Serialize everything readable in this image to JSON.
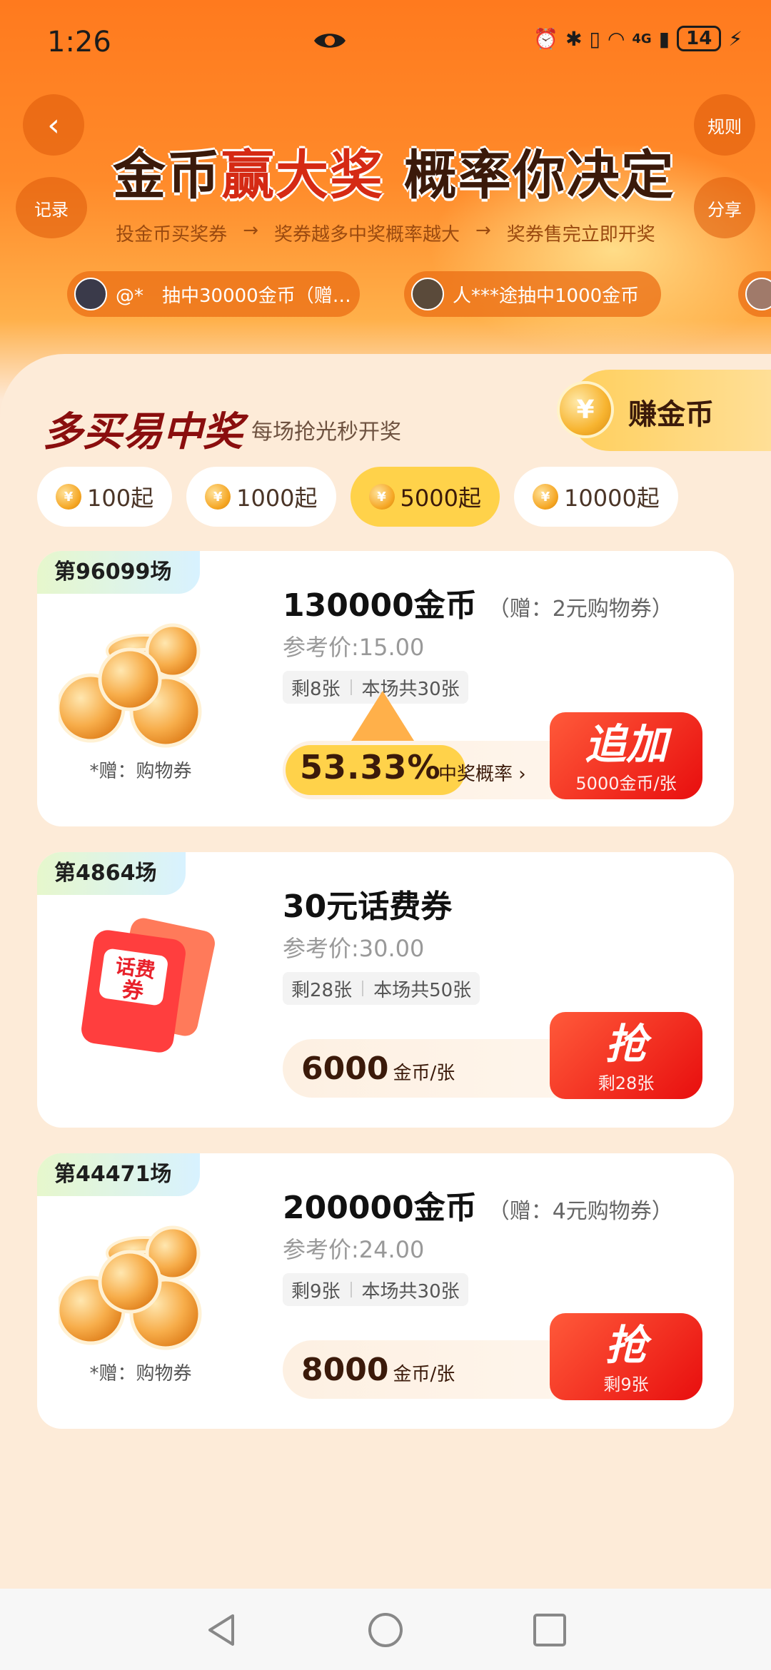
{
  "status": {
    "time": "1:26",
    "battery": "14",
    "network": "4G"
  },
  "header": {
    "back_icon": "chevron-left-icon",
    "record_label": "记录",
    "rules_label": "规则",
    "share_label": "分享",
    "headline_part1": "金币",
    "headline_part2": "赢大奖",
    "headline_part3": "概率你决定",
    "steps": [
      "投金币买奖券",
      "奖券越多中奖概率越大",
      "奖券售完立即开奖"
    ],
    "step_arrow": "→",
    "ticker": [
      {
        "text": "@*　抽中30000金币（赠…"
      },
      {
        "text": "人***途抽中1000金币"
      }
    ]
  },
  "section": {
    "title": "多买易中奖",
    "subtitle": "每场抢光秒开奖",
    "earn_label": "赚金币",
    "coin_glyph": "¥"
  },
  "filters": [
    {
      "label": "100起",
      "active": false
    },
    {
      "label": "1000起",
      "active": false
    },
    {
      "label": "5000起",
      "active": true
    },
    {
      "label": "10000起",
      "active": false
    }
  ],
  "cards": [
    {
      "round": "第96099场",
      "title": "130000金币",
      "gift": "（赠：2元购物券）",
      "ref_price": "参考价:15.00",
      "remaining": "剩8张",
      "total": "本场共30张",
      "image_note": "*赠：购物券",
      "probability": "53.33%",
      "probability_label": "中奖概率 ›",
      "cta": "追加",
      "cta_sub": "5000金币/张"
    },
    {
      "round": "第4864场",
      "title": "30元话费券",
      "ref_price": "参考价:30.00",
      "remaining": "剩28张",
      "total": "本场共50张",
      "voucher_text_1": "话费",
      "voucher_text_2": "券",
      "price": "6000",
      "price_unit": "金币/张",
      "cta": "抢",
      "cta_sub": "剩28张"
    },
    {
      "round": "第44471场",
      "title": "200000金币",
      "gift": "（赠：4元购物券）",
      "ref_price": "参考价:24.00",
      "remaining": "剩9张",
      "total": "本场共30张",
      "image_note": "*赠：购物券",
      "price": "8000",
      "price_unit": "金币/张",
      "cta": "抢",
      "cta_sub": "剩9张"
    }
  ],
  "navbar": {
    "back": "triangle-back-icon",
    "home": "circle-home-icon",
    "recents": "square-recents-icon"
  },
  "colors": {
    "primary_orange": "#ff7a1e",
    "cta_red": "#e80e0e",
    "chip_active": "#ffd24a",
    "dark_brown": "#3b1a0a"
  }
}
